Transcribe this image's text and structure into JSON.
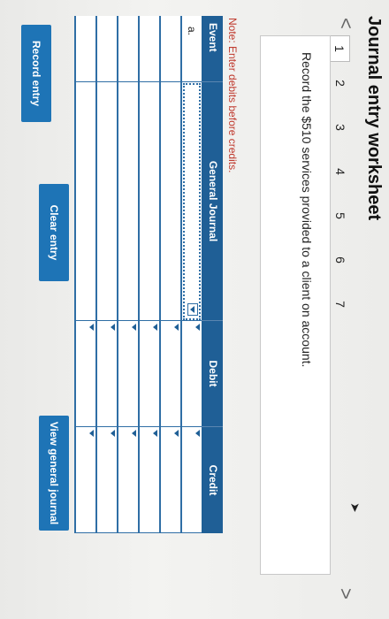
{
  "header": {
    "title": "Journal entry worksheet"
  },
  "pager": {
    "prev_icon": "chevron-left-icon",
    "next_icon": "chevron-right-icon",
    "prev_glyph": "<",
    "next_glyph": ">",
    "pages": [
      "1",
      "2",
      "3",
      "4",
      "5",
      "6",
      "7"
    ],
    "active": "1"
  },
  "question": {
    "text": "Record the $510 services provided to a client on account."
  },
  "note": "Note: Enter debits before credits.",
  "table": {
    "headers": {
      "event": "Event",
      "journal": "General Journal",
      "debit": "Debit",
      "credit": "Credit"
    },
    "first_event": "a."
  },
  "buttons": {
    "record": "Record entry",
    "clear": "Clear entry",
    "view": "View general journal"
  },
  "colors": {
    "accent": "#1e74b6",
    "header": "#1f5f96",
    "note": "#c03b2f"
  }
}
